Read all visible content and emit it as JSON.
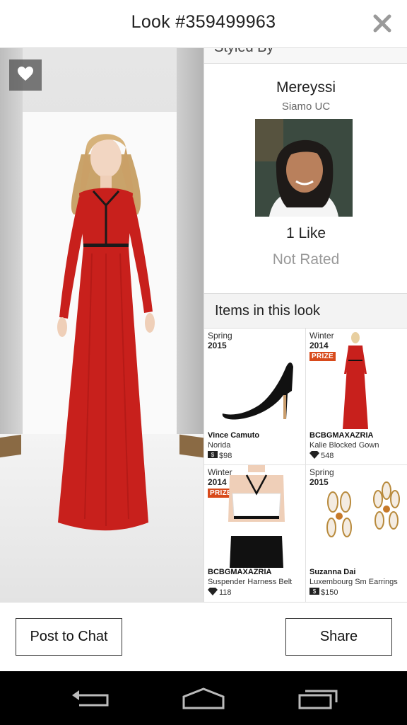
{
  "header": {
    "title": "Look #359499963"
  },
  "stylist": {
    "section_label": "Styled By",
    "name": "Mereyssi",
    "subtitle": "Siamo UC",
    "likes": "1 Like",
    "rating": "Not Rated"
  },
  "items_header": "Items in this look",
  "items": [
    {
      "season": "Spring",
      "year": "2015",
      "prize": "",
      "brand": "Vince Camuto",
      "name": "Norida",
      "price": "$98",
      "currency_icon": "cash-icon"
    },
    {
      "season": "Winter",
      "year": "2014",
      "prize": "PRIZE",
      "brand": "BCBGMAXAZRIA",
      "name": "Kalie Blocked Gown",
      "price": "548",
      "currency_icon": "diamond-icon"
    },
    {
      "season": "Winter",
      "year": "2014",
      "prize": "PRIZE",
      "brand": "BCBGMAXAZRIA",
      "name": "Suspender Harness Belt",
      "price": "118",
      "currency_icon": "diamond-icon"
    },
    {
      "season": "Spring",
      "year": "2015",
      "prize": "",
      "brand": "Suzanna Dai",
      "name": "Luxembourg Sm Earrings",
      "price": "$150",
      "currency_icon": "cash-icon"
    }
  ],
  "buttons": {
    "post_to_chat": "Post to Chat",
    "share": "Share"
  },
  "colors": {
    "prize_badge": "#d84a1b",
    "dress_red": "#c8201c",
    "navbar": "#000000"
  }
}
